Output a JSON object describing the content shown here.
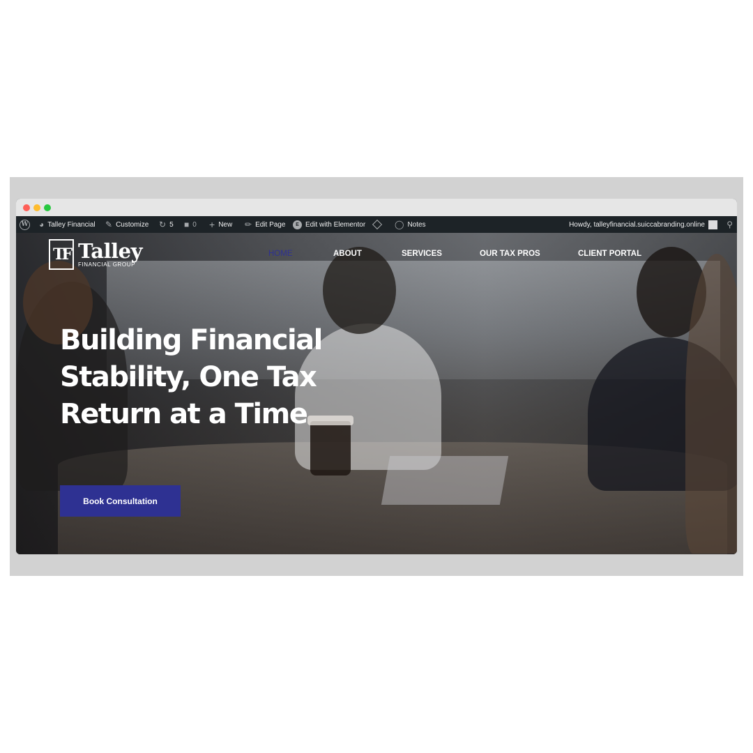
{
  "admin_bar": {
    "site_name": "Talley Financial",
    "customize": "Customize",
    "updates_count": "5",
    "comments_count": "0",
    "new": "New",
    "edit_page": "Edit Page",
    "edit_elementor": "Edit with Elementor",
    "notes": "Notes",
    "howdy": "Howdy, talleyfinancial.suiccabranding.online"
  },
  "logo": {
    "mark": "TF",
    "name": "Talley",
    "subtitle": "FINANCIAL GROUP"
  },
  "nav": {
    "items": [
      {
        "label": "HOME",
        "active": true
      },
      {
        "label": "ABOUT"
      },
      {
        "label": "SERVICES"
      },
      {
        "label": "OUR TAX PROS"
      },
      {
        "label": "CLIENT PORTAL"
      }
    ]
  },
  "hero": {
    "heading": "Building Financial Stability, One Tax Return at a Time",
    "cta_label": "Book Consultation"
  },
  "colors": {
    "brand_blue": "#2e3192",
    "admin_bar_bg": "#1d2327",
    "frame_gray": "#d2d2d2"
  }
}
